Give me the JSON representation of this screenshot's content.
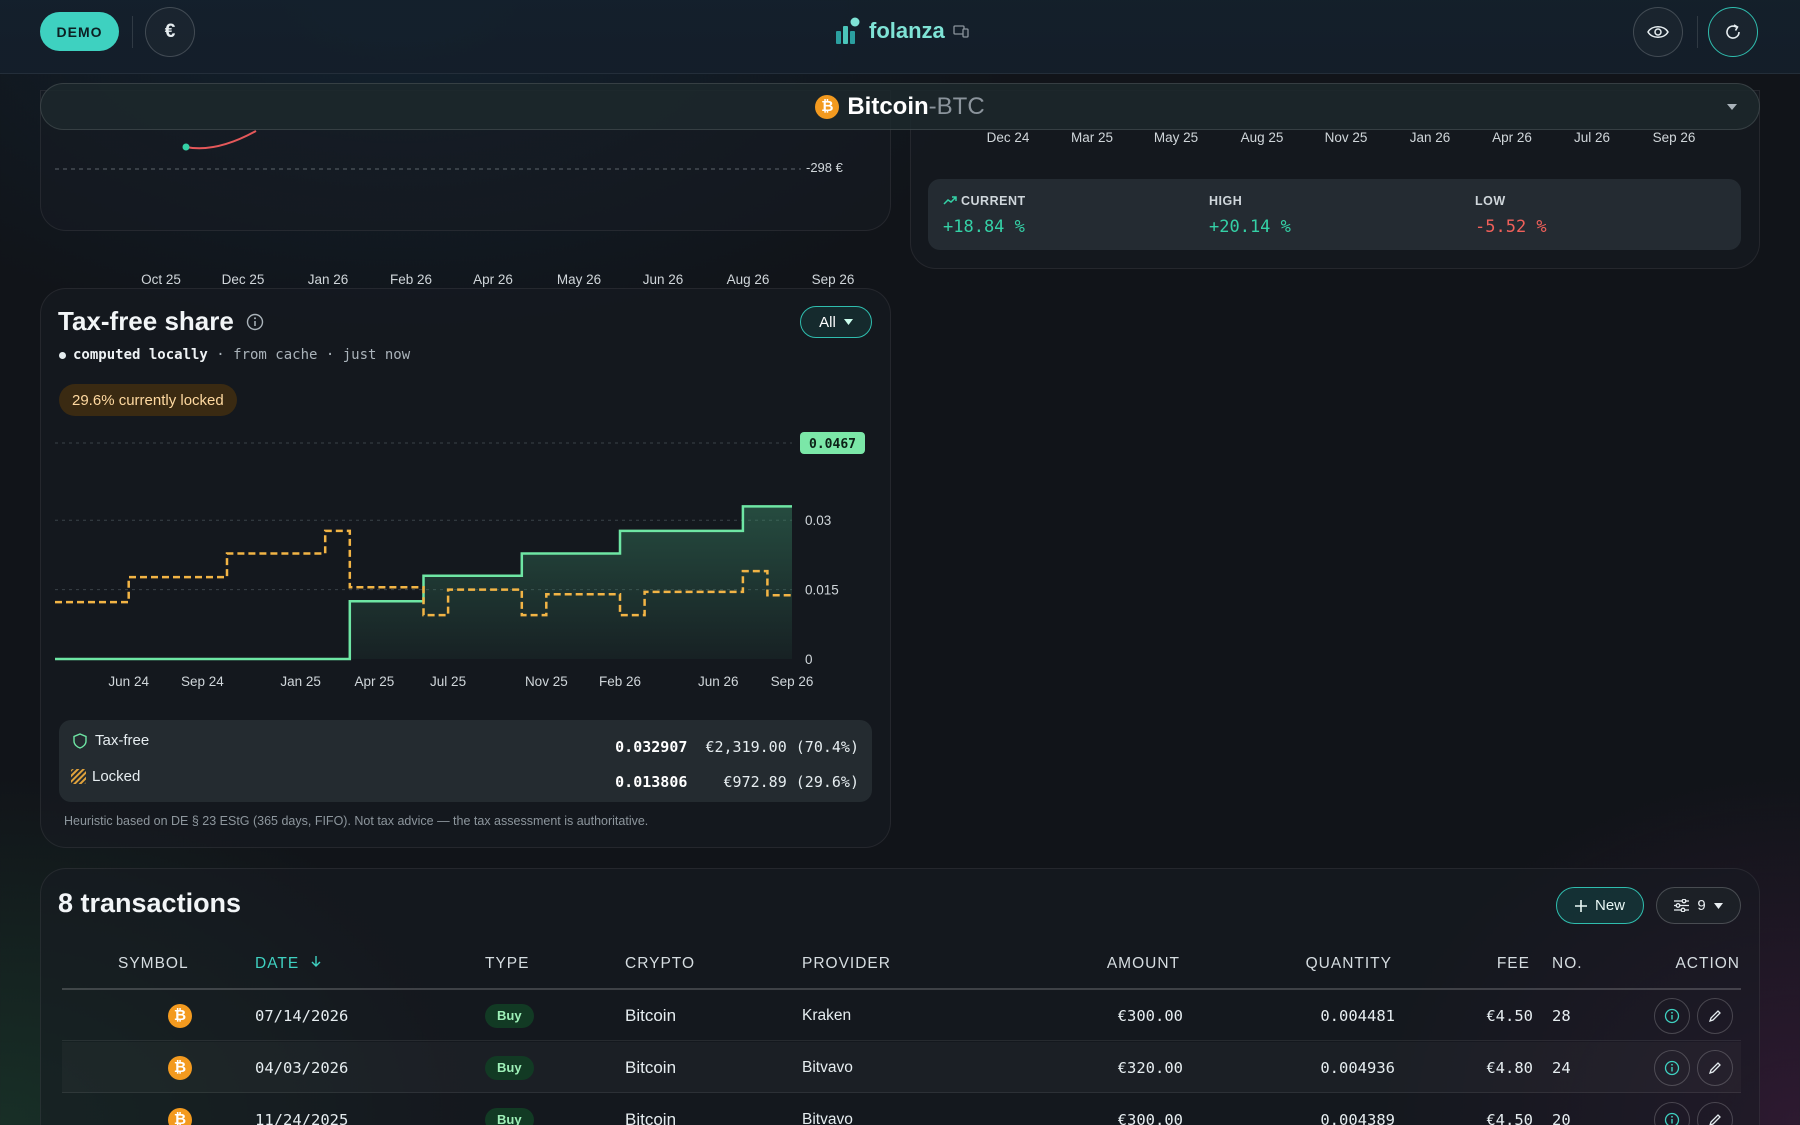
{
  "header": {
    "demo_label": "DEMO",
    "currency_symbol": "€",
    "brand_name": "folanza"
  },
  "asset": {
    "icon_letter": "₿",
    "name": "Bitcoin",
    "separator": " - ",
    "symbol": "BTC"
  },
  "top_left_chart": {
    "right_label": "-298 €",
    "x_ticks": [
      "Oct 25",
      "Dec 25",
      "Jan 26",
      "Feb 26",
      "Apr 26",
      "May 26",
      "Jun 26",
      "Aug 26",
      "Sep 26"
    ]
  },
  "top_right_chart": {
    "x_ticks": [
      "Dec 24",
      "Mar 25",
      "May 25",
      "Aug 25",
      "Nov 25",
      "Jan 26",
      "Apr 26",
      "Jul 26",
      "Sep 26"
    ]
  },
  "stats": {
    "current_label": "CURRENT",
    "current_value": "+18.84 %",
    "high_label": "HIGH",
    "high_value": "+20.14 %",
    "low_label": "LOW",
    "low_value": "-5.52 %",
    "colors": {
      "positive": "#34d1a6",
      "negative": "#f0605a"
    }
  },
  "taxfree": {
    "title": "Tax-free share",
    "status_bold": "computed locally",
    "status_rest": " · from cache · just now",
    "filter_label": "All",
    "locked_badge": "29.6% currently locked",
    "tax_free_label": "Tax-free",
    "tax_free_qty": "0.032907",
    "tax_free_value": "€2,319.00 (70.4%)",
    "locked_label": "Locked",
    "locked_qty": "0.013806",
    "locked_value": "€972.89 (29.6%)",
    "footnote": "Heuristic based on DE § 23 EStG (365 days, FIFO). Not tax advice — the tax assessment is authoritative."
  },
  "chart_data": {
    "type": "line",
    "title": "Tax-free share",
    "x": [
      "2024-03",
      "2024-06",
      "2024-09",
      "2025-01",
      "2025-04",
      "2025-07",
      "2025-11",
      "2026-02",
      "2026-06",
      "2026-09"
    ],
    "x_ticks": [
      "Jun 24",
      "Sep 24",
      "Jan 25",
      "Apr 25",
      "Jul 25",
      "Nov 25",
      "Feb 26",
      "Jun 26",
      "Sep 26"
    ],
    "y_ticks": [
      "0",
      "0.015",
      "0.03"
    ],
    "ylim": [
      0,
      0.0467
    ],
    "current_value_label": "0.0467",
    "series": [
      {
        "name": "Tax-free",
        "style": "solid",
        "color": "#6ee6a4",
        "points": [
          [
            "2024-03",
            0
          ],
          [
            "2025-03",
            0
          ],
          [
            "2025-03",
            0.0125
          ],
          [
            "2025-06",
            0.0125
          ],
          [
            "2025-06",
            0.018
          ],
          [
            "2025-10",
            0.018
          ],
          [
            "2025-10",
            0.0228
          ],
          [
            "2026-02",
            0.0228
          ],
          [
            "2026-02",
            0.0277
          ],
          [
            "2026-07",
            0.0277
          ],
          [
            "2026-07",
            0.033
          ],
          [
            "2026-09",
            0.033
          ]
        ]
      },
      {
        "name": "Locked",
        "style": "dashed",
        "color": "#f2b445",
        "points": [
          [
            "2024-03",
            0.0123
          ],
          [
            "2024-06",
            0.0123
          ],
          [
            "2024-06",
            0.0177
          ],
          [
            "2024-10",
            0.0177
          ],
          [
            "2024-10",
            0.0228
          ],
          [
            "2025-02",
            0.0228
          ],
          [
            "2025-02",
            0.0277
          ],
          [
            "2025-03",
            0.0277
          ],
          [
            "2025-03",
            0.0155
          ],
          [
            "2025-06",
            0.0155
          ],
          [
            "2025-06",
            0.0095
          ],
          [
            "2025-07",
            0.0095
          ],
          [
            "2025-07",
            0.015
          ],
          [
            "2025-10",
            0.015
          ],
          [
            "2025-10",
            0.0095
          ],
          [
            "2025-11",
            0.0095
          ],
          [
            "2025-11",
            0.014
          ],
          [
            "2026-02",
            0.014
          ],
          [
            "2026-02",
            0.0095
          ],
          [
            "2026-03",
            0.0095
          ],
          [
            "2026-03",
            0.0145
          ],
          [
            "2026-07",
            0.0145
          ],
          [
            "2026-07",
            0.019
          ],
          [
            "2026-08",
            0.019
          ],
          [
            "2026-08",
            0.0138
          ],
          [
            "2026-09",
            0.0138
          ]
        ]
      }
    ]
  },
  "transactions": {
    "title": "8 transactions",
    "new_label": "New",
    "filter_count": "9",
    "columns": [
      "SYMBOL",
      "DATE",
      "TYPE",
      "CRYPTO",
      "PROVIDER",
      "AMOUNT",
      "QUANTITY",
      "FEE",
      "NO.",
      "ACTION"
    ],
    "rows": [
      {
        "date": "07/14/2026",
        "type": "Buy",
        "crypto": "Bitcoin",
        "provider": "Kraken",
        "amount": "€300.00",
        "quantity": "0.004481",
        "fee": "€4.50",
        "no": "28"
      },
      {
        "date": "04/03/2026",
        "type": "Buy",
        "crypto": "Bitcoin",
        "provider": "Bitvavo",
        "amount": "€320.00",
        "quantity": "0.004936",
        "fee": "€4.80",
        "no": "24"
      },
      {
        "date": "11/24/2025",
        "type": "Buy",
        "crypto": "Bitcoin",
        "provider": "Bitvavo",
        "amount": "€300.00",
        "quantity": "0.004389",
        "fee": "€4.50",
        "no": "20"
      }
    ]
  }
}
